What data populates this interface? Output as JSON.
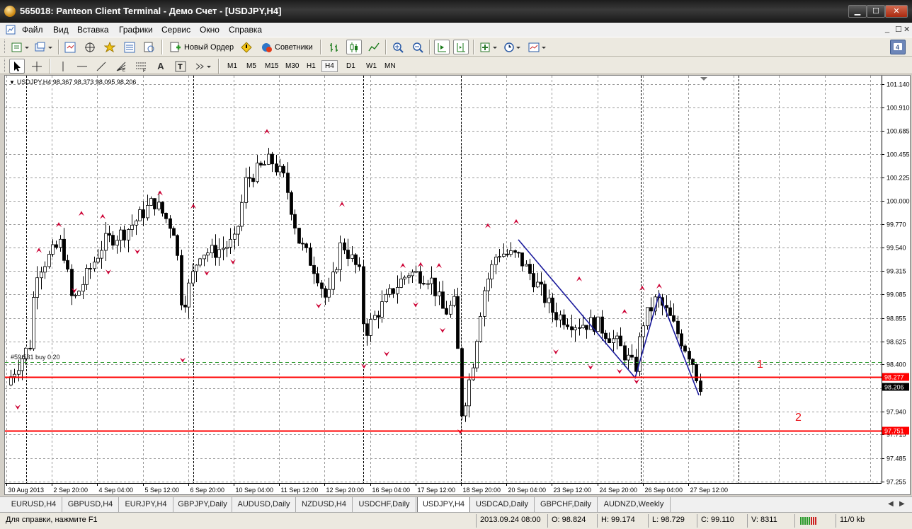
{
  "window": {
    "title": "565018: Panteon Client Terminal - Демо Счет - [USDJPY,H4]",
    "minimize": "▁",
    "maximize": "☐",
    "close": "✕"
  },
  "menu": [
    "Файл",
    "Вид",
    "Вставка",
    "Графики",
    "Сервис",
    "Окно",
    "Справка"
  ],
  "mdi_controls": [
    "_",
    "☐",
    "✕"
  ],
  "toolbar1": {
    "new_order": "Новый Ордер",
    "experts": "Советники"
  },
  "toolbar2": {
    "timeframes": [
      "M1",
      "M5",
      "M15",
      "M30",
      "H1",
      "H4",
      "D1",
      "W1",
      "MN"
    ],
    "active_timeframe": "H4"
  },
  "chart": {
    "header": "USDJPY,H4  98.367 98.373 98.095 98.206",
    "order_label": "#59 531 buy 0.20",
    "price_labels": [
      "101.140",
      "100.910",
      "100.685",
      "100.455",
      "100.225",
      "100.000",
      "99.770",
      "99.540",
      "99.315",
      "99.085",
      "98.855",
      "98.625",
      "98.400",
      "98.170",
      "97.940",
      "97.715",
      "97.485",
      "97.255"
    ],
    "time_labels": [
      "30 Aug 2013",
      "2 Sep 20:00",
      "4 Sep 04:00",
      "5 Sep 12:00",
      "6 Sep 20:00",
      "10 Sep 04:00",
      "11 Sep 12:00",
      "12 Sep 20:00",
      "16 Sep 04:00",
      "17 Sep 12:00",
      "18 Sep 20:00",
      "20 Sep 04:00",
      "23 Sep 12:00",
      "24 Sep 20:00",
      "26 Sep 04:00",
      "27 Sep 12:00"
    ],
    "levels": [
      {
        "price": 98.277,
        "label": "98.277",
        "annotation": "1",
        "color": "#ff0000"
      },
      {
        "price": 97.751,
        "label": "97.751",
        "annotation": "2",
        "color": "#ff0000"
      }
    ],
    "bid_label": "98.206",
    "order_price": 98.42,
    "colors": {
      "fractal": "#cc0033",
      "trendline": "#1a1a9c",
      "level": "#ff0000",
      "grid": "#9a9a9a"
    }
  },
  "tabs": [
    "EURUSD,H4",
    "GBPUSD,H4",
    "EURJPY,H4",
    "GBPJPY,Daily",
    "AUDUSD,Daily",
    "NZDUSD,H4",
    "USDCHF,Daily",
    "USDJPY,H4",
    "USDCAD,Daily",
    "GBPCHF,Daily",
    "AUDNZD,Weekly"
  ],
  "active_tab": "USDJPY,H4",
  "status": {
    "help": "Для справки, нажмите F1",
    "time": "2013.09.24 08:00",
    "open": "O: 98.824",
    "high": "H: 99.174",
    "low": "L: 98.729",
    "close": "C: 99.110",
    "volume": "V: 8311",
    "traffic": "11/0 kb"
  }
}
